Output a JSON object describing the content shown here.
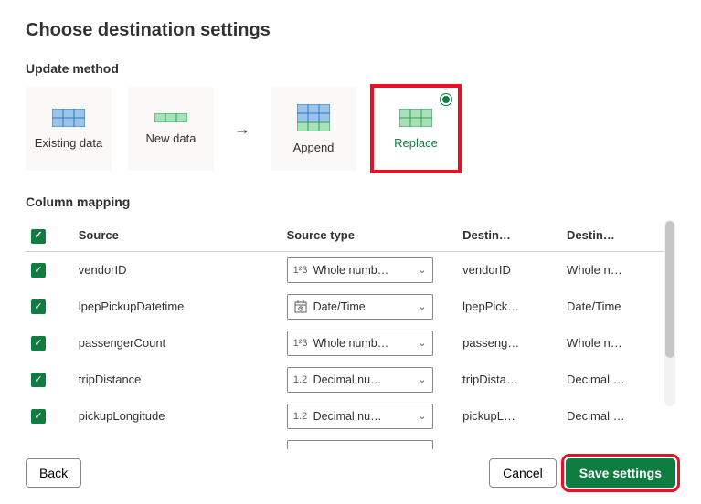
{
  "title": "Choose destination settings",
  "update_method": {
    "label": "Update method",
    "existing": "Existing data",
    "newdata": "New data",
    "append": "Append",
    "replace": "Replace"
  },
  "mapping": {
    "label": "Column mapping",
    "headers": {
      "source": "Source",
      "source_type": "Source type",
      "dest": "Destin…",
      "dest_type": "Destin…"
    },
    "rows": [
      {
        "source": "vendorID",
        "type_icon": "1²3",
        "type_label": "Whole numb…",
        "dest": "vendorID",
        "dest_type": "Whole n…"
      },
      {
        "source": "lpepPickupDatetime",
        "type_icon": "cal",
        "type_label": "Date/Time",
        "dest": "lpepPick…",
        "dest_type": "Date/Time"
      },
      {
        "source": "passengerCount",
        "type_icon": "1²3",
        "type_label": "Whole numb…",
        "dest": "passeng…",
        "dest_type": "Whole n…"
      },
      {
        "source": "tripDistance",
        "type_icon": "1.2",
        "type_label": "Decimal nu…",
        "dest": "tripDista…",
        "dest_type": "Decimal …"
      },
      {
        "source": "pickupLongitude",
        "type_icon": "1.2",
        "type_label": "Decimal nu…",
        "dest": "pickupL…",
        "dest_type": "Decimal …"
      }
    ]
  },
  "buttons": {
    "back": "Back",
    "cancel": "Cancel",
    "save": "Save settings"
  },
  "icons": {
    "check": "✓",
    "chevron": "⌄"
  }
}
